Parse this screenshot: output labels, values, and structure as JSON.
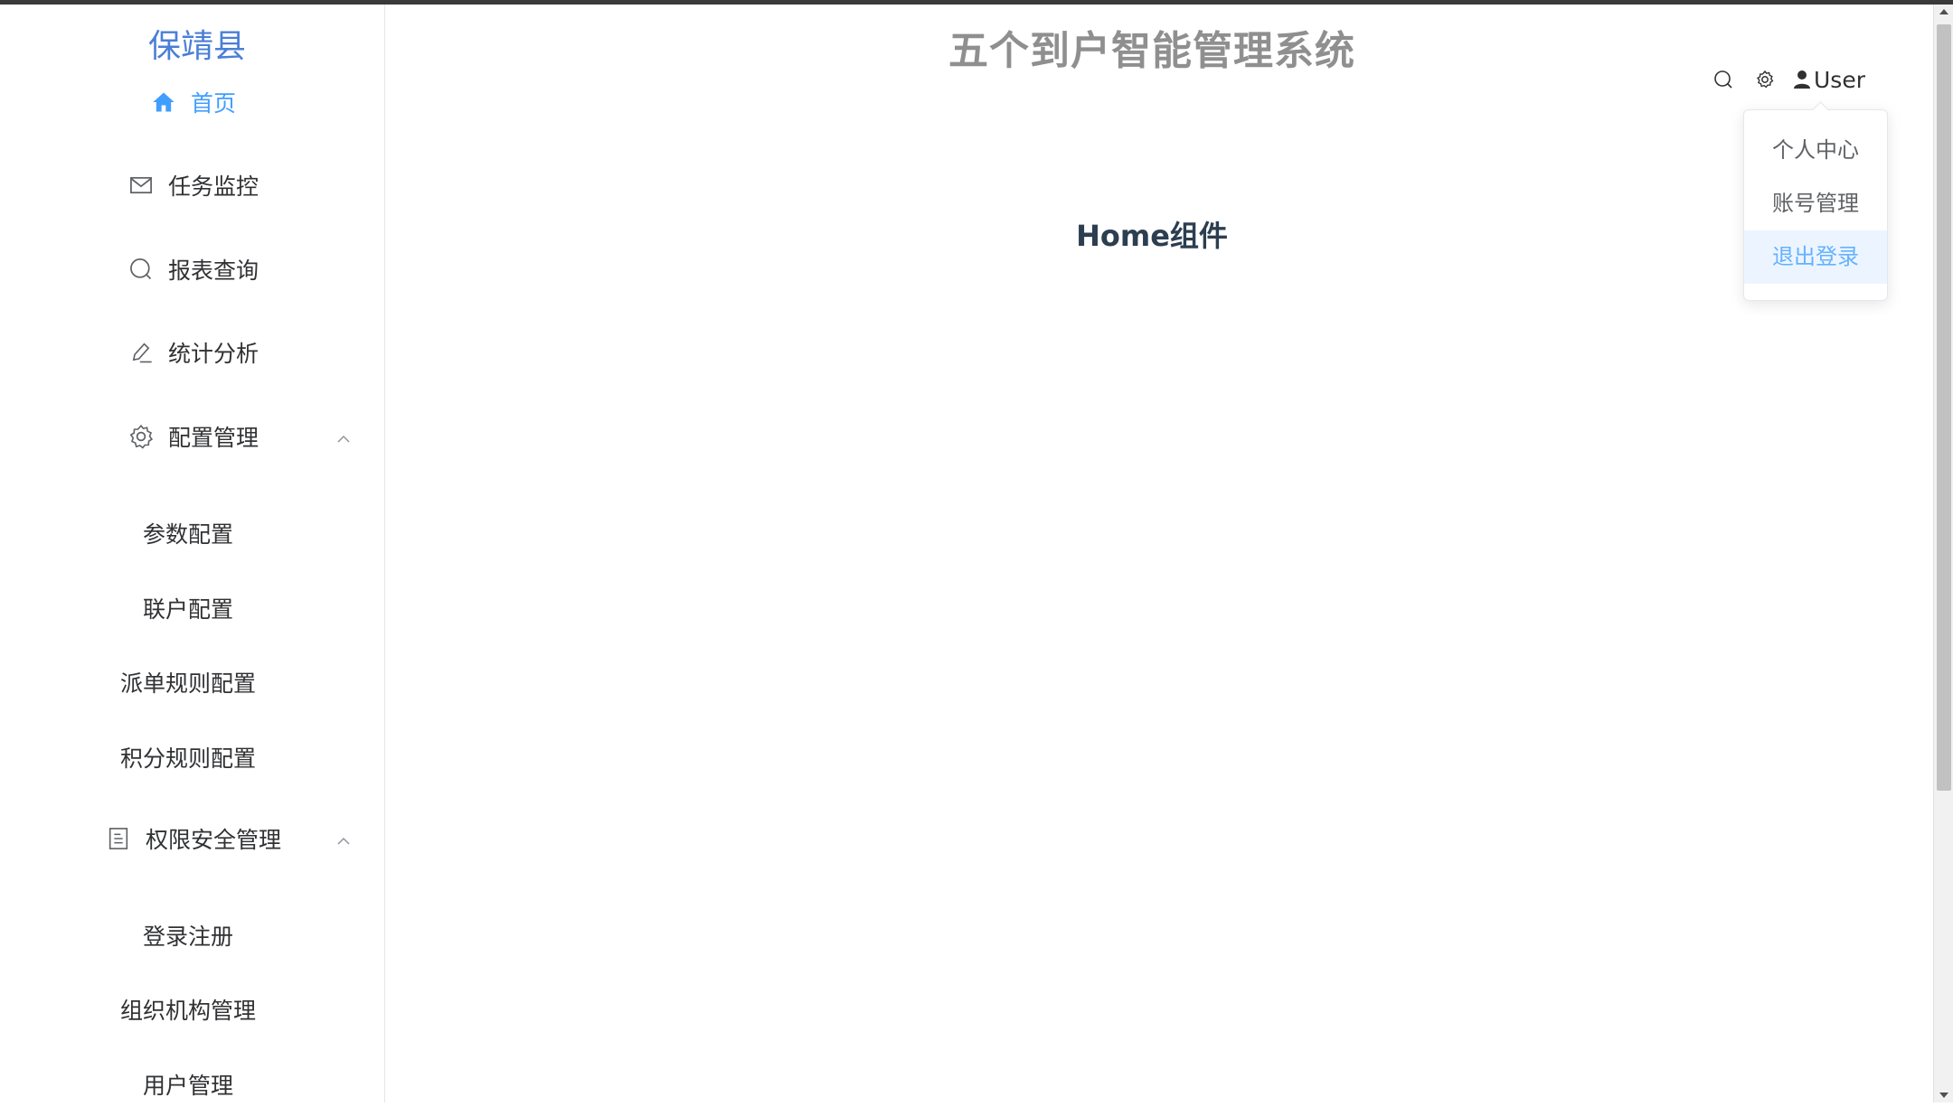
{
  "sidebar": {
    "brand": "保靖县",
    "items": [
      {
        "label": "首页",
        "icon": "home-icon"
      },
      {
        "label": "任务监控",
        "icon": "mail-icon"
      },
      {
        "label": "报表查询",
        "icon": "search-icon"
      },
      {
        "label": "统计分析",
        "icon": "edit-icon"
      },
      {
        "label": "配置管理",
        "icon": "gear-icon"
      },
      {
        "label": "权限安全管理",
        "icon": "document-icon"
      }
    ],
    "config_sub": [
      "参数配置",
      "联户配置",
      "派单规则配置",
      "积分规则配置"
    ],
    "security_sub": [
      "登录注册",
      "组织机构管理",
      "用户管理"
    ]
  },
  "header": {
    "title": "五个到户智能管理系统",
    "user_label": "User"
  },
  "user_menu": {
    "items": [
      "个人中心",
      "账号管理",
      "退出登录"
    ]
  },
  "main": {
    "heading": "Home组件"
  },
  "colors": {
    "accent": "#409eff",
    "brand": "#4a7fd6",
    "title": "#8f8f8f"
  }
}
